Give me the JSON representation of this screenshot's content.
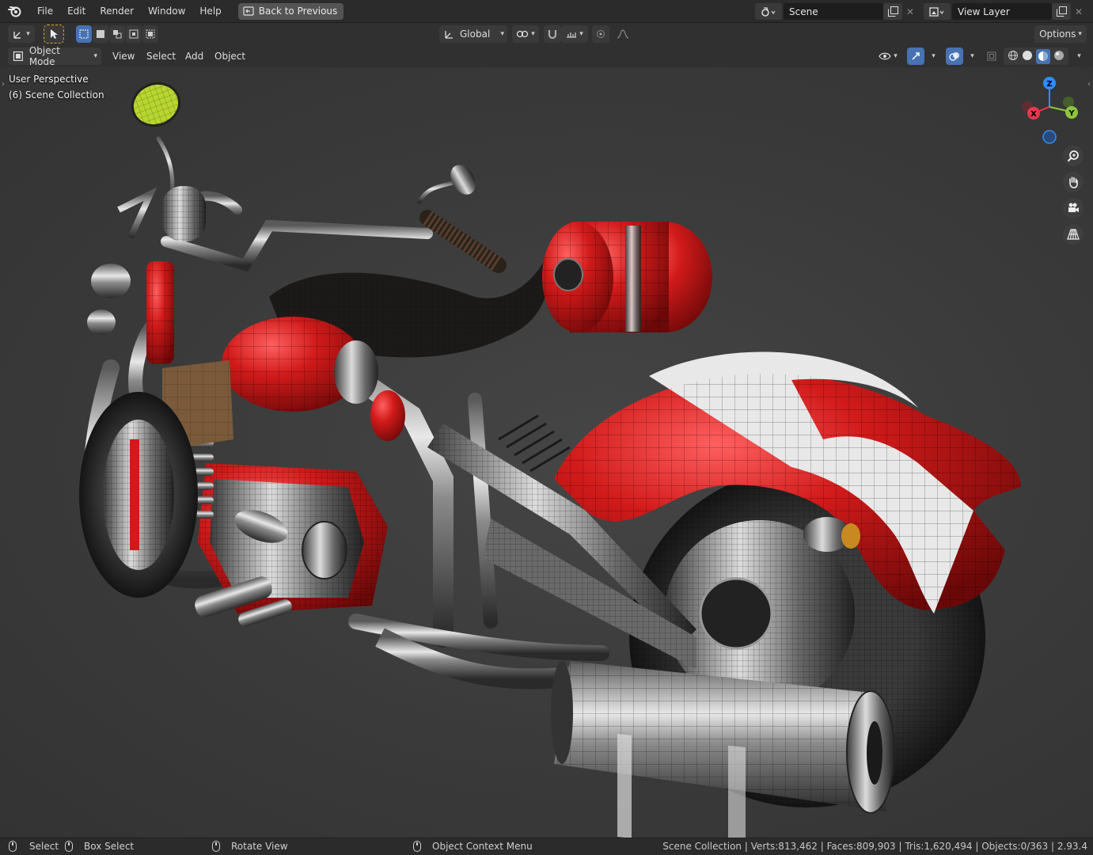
{
  "menubar": {
    "items": [
      "File",
      "Edit",
      "Render",
      "Window",
      "Help"
    ],
    "back_button": "Back to Previous",
    "scene_field": "Scene",
    "view_layer_field": "View Layer"
  },
  "toolbar": {
    "transform_orientation": "Global",
    "options_label": "Options"
  },
  "header": {
    "mode": "Object Mode",
    "menus": [
      "View",
      "Select",
      "Add",
      "Object"
    ]
  },
  "viewport": {
    "perspective": "User Perspective",
    "collection": "(6) Scene Collection",
    "gizmo_axes": {
      "x": "X",
      "y": "Y",
      "z": "Z"
    }
  },
  "statusbar": {
    "select": "Select",
    "box_select": "Box Select",
    "rotate_view": "Rotate View",
    "context_menu": "Object Context Menu",
    "stats": "Scene Collection | Verts:813,462 | Faces:809,903 | Tris:1,620,494 | Objects:0/363 | 2.93.4"
  },
  "colors": {
    "accent_blue": "#4772b3",
    "axis_x": "#e8384f",
    "axis_y": "#8cc63f",
    "axis_z": "#2c8fff",
    "bike_red": "#d21a1a"
  },
  "icons": [
    "blender-logo-icon",
    "back-icon",
    "scene-icon",
    "view-layer-icon",
    "copy-icon",
    "close-icon",
    "select-cursor-icon",
    "zoom-icon",
    "hand-pan-icon",
    "camera-icon",
    "grid-icon"
  ]
}
